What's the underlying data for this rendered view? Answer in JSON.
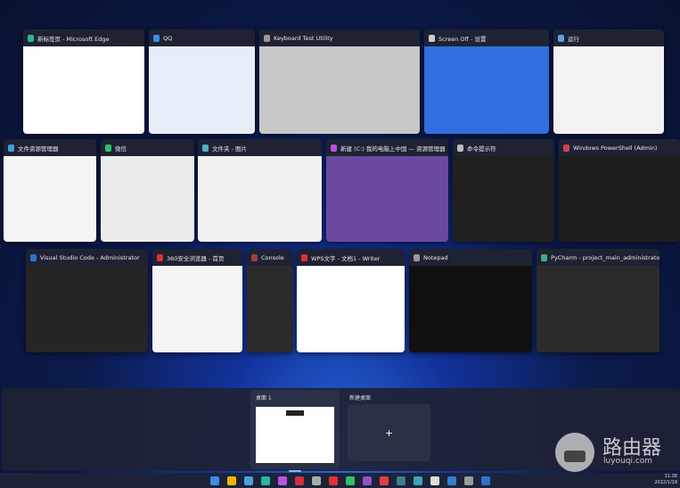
{
  "windows": [
    {
      "title": "新标签页 - Microsoft Edge",
      "icon": "edge-icon",
      "color": "#2bb5a0",
      "thumb": "#ffffff"
    },
    {
      "title": "QQ",
      "icon": "qq-icon",
      "color": "#3a8ee6",
      "thumb": "#e8eef7"
    },
    {
      "title": "Keyboard Test Utility",
      "icon": "keyboard-icon",
      "color": "#999999",
      "thumb": "#c8c8c8"
    },
    {
      "title": "Screen Off - 设置",
      "icon": "settings-icon",
      "color": "#cccccc",
      "thumb": "#2f6fe0"
    },
    {
      "title": "运行",
      "icon": "run-icon",
      "color": "#5aa0e8",
      "thumb": "#f2f2f2"
    },
    {
      "title": "文件资源管理器",
      "icon": "folder-icon",
      "color": "#3aa0d8",
      "thumb": "#f4f4f4"
    },
    {
      "title": "微信",
      "icon": "wechat-icon",
      "color": "#2dc16b",
      "thumb": "#ececec"
    },
    {
      "title": "文件夹 - 图片",
      "icon": "photos-icon",
      "color": "#4fb0c8",
      "thumb": "#f0f0f0"
    },
    {
      "title": "新建 (C:) 我的电脑上中国 — 资源管理器",
      "icon": "browser-icon",
      "color": "#c050e0",
      "thumb": "#6a4aa0"
    },
    {
      "title": "命令提示符",
      "icon": "terminal-icon",
      "color": "#bbbbbb",
      "thumb": "#202020"
    },
    {
      "title": "Windows PowerShell (Admin)",
      "icon": "ide-icon",
      "color": "#d04050",
      "thumb": "#1e1e1e"
    },
    {
      "title": "Visual Studio Code - Administrator",
      "icon": "ide-icon",
      "color": "#3070d0",
      "thumb": "#252526"
    },
    {
      "title": "360安全浏览器 - 首页",
      "icon": "browser-icon",
      "color": "#e03030",
      "thumb": "#f5f5f5"
    },
    {
      "title": "Console",
      "icon": "console-icon",
      "color": "#a04040",
      "thumb": "#2b2b2b"
    },
    {
      "title": "WPS文字 - 文档1 - Writer",
      "icon": "wps-icon",
      "color": "#e03030",
      "thumb": "#ffffff"
    },
    {
      "title": "Notepad",
      "icon": "notepad-icon",
      "color": "#999999",
      "thumb": "#101010"
    },
    {
      "title": "PyCharm - project_main_administrator",
      "icon": "ide-icon",
      "color": "#40b080",
      "thumb": "#2b2b2b"
    }
  ],
  "desktops": {
    "current": "桌面 1",
    "new_label": "新建桌面",
    "add_symbol": "+"
  },
  "watermark": {
    "brand": "路由器",
    "site": "luyouqi.com"
  },
  "taskbar": {
    "time": "11:38",
    "date": "2022/1/18"
  }
}
